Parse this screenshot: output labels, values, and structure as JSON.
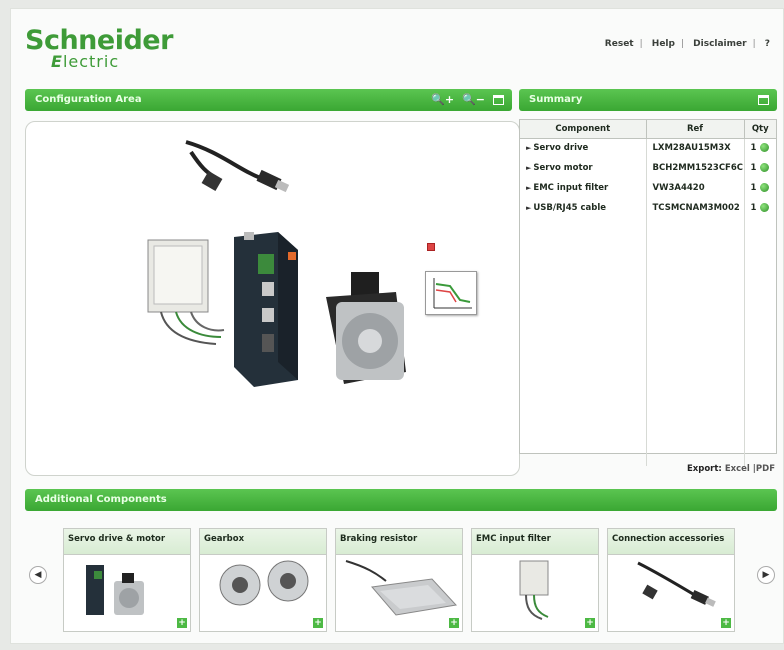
{
  "brand": {
    "name": "Schneider",
    "sub_prefix": "",
    "sub_e": "E",
    "sub": "lectric",
    "color": "#3e9b38"
  },
  "toplinks": {
    "reset": "Reset",
    "help": "Help",
    "disclaimer": "Disclaimer",
    "question": "?"
  },
  "config": {
    "title": "Configuration Area"
  },
  "summary": {
    "title": "Summary",
    "columns": [
      "Component",
      "Ref",
      "Qty"
    ],
    "rows": [
      {
        "component": "Servo drive",
        "ref": "LXM28AU15M3X",
        "qty": "1"
      },
      {
        "component": "Servo motor",
        "ref": "BCH2MM1523CF6C",
        "qty": "1"
      },
      {
        "component": "EMC input filter",
        "ref": "VW3A4420",
        "qty": "1"
      },
      {
        "component": "USB/RJ45 cable",
        "ref": "TCSMCNAM3M002",
        "qty": "1"
      }
    ]
  },
  "export": {
    "label": "Export:",
    "excel": "Excel",
    "pdf": "PDF"
  },
  "additional": {
    "title": "Additional Components",
    "cards": [
      {
        "label": "Servo drive & motor"
      },
      {
        "label": "Gearbox"
      },
      {
        "label": "Braking resistor"
      },
      {
        "label": "EMC input filter"
      },
      {
        "label": "Connection accessories"
      }
    ]
  },
  "accent": "#44b33c"
}
